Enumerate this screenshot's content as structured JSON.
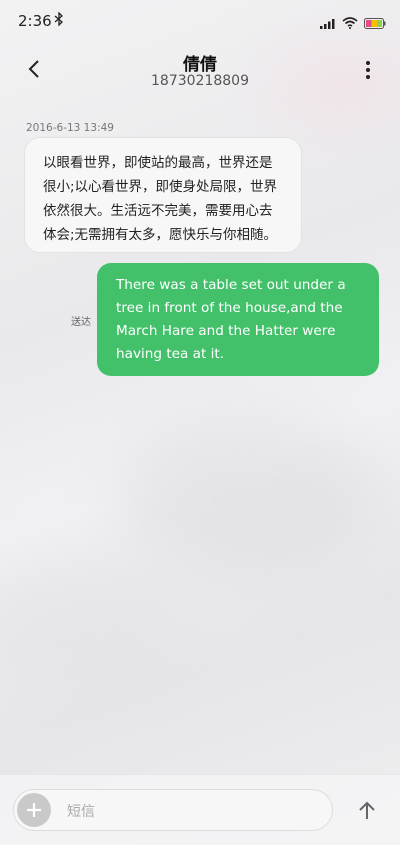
{
  "status": {
    "time": "2:36"
  },
  "header": {
    "name": "倩倩",
    "number": "18730218809"
  },
  "conversation": {
    "timestamp": "2016-6-13 13:49",
    "incoming_text": "以眼看世界，即使站的最高，世界还是很小;以心看世界，即使身处局限，世界依然很大。生活远不完美，需要用心去体会;无需拥有太多，愿快乐与你相随。",
    "outgoing_text": "There was a table set out under a tree in front of the house,and the March Hare and the Hatter were having tea at it.",
    "outgoing_status": "送达"
  },
  "composer": {
    "placeholder": "短信"
  },
  "icons": {
    "bluetooth": "bluetooth-icon",
    "signal": "signal-icon",
    "wifi": "wifi-icon",
    "battery": "battery-icon",
    "back": "back-arrow-icon",
    "menu": "more-vertical-icon",
    "attach": "plus-icon",
    "send": "send-arrow-icon"
  },
  "colors": {
    "outgoing_bubble": "#43c16a",
    "incoming_bubble": "#f7f7f7"
  }
}
